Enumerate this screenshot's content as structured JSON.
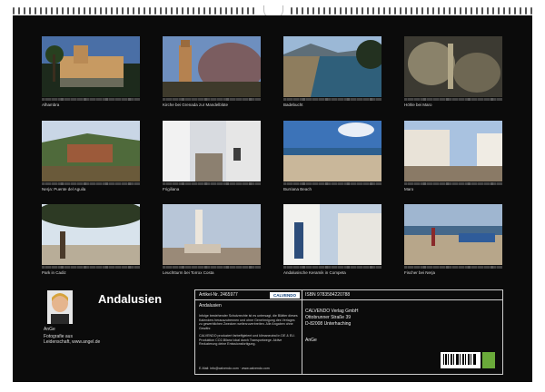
{
  "calendar": {
    "photos": [
      {
        "caption": "Alhambra"
      },
      {
        "caption": "Kirche bei Grenada zur Mandelblüte"
      },
      {
        "caption": "Badebucht"
      },
      {
        "caption": "Höhle bei Maro"
      },
      {
        "caption": "Nerja: Puente del Aguila"
      },
      {
        "caption": "Frigiliana"
      },
      {
        "caption": "Burriana Beach"
      },
      {
        "caption": "Maro"
      },
      {
        "caption": "Park in Cadiz"
      },
      {
        "caption": "Leuchtturm bei Torrox Costa"
      },
      {
        "caption": "Andalusische Keramik in Competa"
      },
      {
        "caption": "Fischer bei Nerja"
      }
    ],
    "title": "Andalusien",
    "author": {
      "name": "AnGe",
      "description": "Fotografie aus",
      "description2": "Leidenschaft, www.angel.de"
    },
    "info": {
      "article": "Artikel-Nr. 2465977",
      "publisher_logo": "CALVENDO",
      "product_title": "Andalusien",
      "legal_text": "Infolge bestehender Schutzrechte ist es untersagt, die Blätter dieses Kalenders herauszutrennen und ohne Genehmigung des Verlages zu gewerblichen Zwecken weiterzuverbreiten. Alle Angaben ohne Gewähr.",
      "production_text": "CALVENDO produziert farbeffgieient und klimaneutral in DE & EU. Produktion CO2-Bilanz lokal durch Transportwege. Aktive Reduzierung deine Emissionsfortigung.",
      "contact": "E-Mail: info@calvendo.com · www.calvendo.com",
      "isbn": "ISBN 9783584220788",
      "publisher_name": "CALVENDO Verlag GmbH",
      "street": "Ottobrunner Straße 39",
      "city": "D-82008 Unterhaching",
      "author_short": "AnGe"
    }
  }
}
